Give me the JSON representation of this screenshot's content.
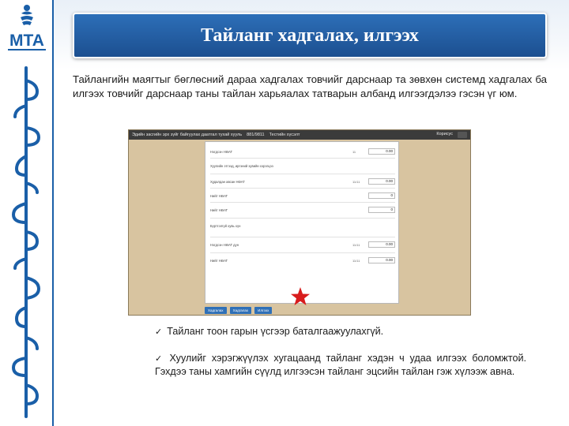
{
  "header": {
    "title": "Тайланг хадгалах, илгээх",
    "logo_text": "MTA"
  },
  "intro": "Тайлангийн маягтыг бөглөсний дараа хадгалах товчийг дарснаар та зөвхөн системд хадгалах ба илгээх товчийг дарснаар таны тайлан харьяалах татварын албанд илгээгдэлээ гэсэн үг юм.",
  "screenshot": {
    "title": "Эдийн засгийн эрх зүйг байгуулах даатгал тухай хууль",
    "code": "881/9811",
    "test": "Тестийн хүсэлт",
    "user": "Корисус",
    "rows": [
      {
        "label": "Нэгдсэн НӨАТ",
        "code": "11",
        "value": "0.00"
      },
      {
        "label": "Хуулийн этгээд, иргэний хувийн хэрэгцээ",
        "code": "",
        "value": ""
      },
      {
        "label": "Худалдан авсан НӨАТ",
        "code": "11/11",
        "value": "0.00"
      },
      {
        "label": "Нийт НӨАТ",
        "code": "",
        "value": "0"
      },
      {
        "label": "Нийт НӨАТ",
        "code": "",
        "value": "0"
      },
      {
        "label": "Бүртгэлгүй хувь хүн",
        "code": "",
        "value": ""
      },
      {
        "label": "Нэгдсэн НӨАТ дүн",
        "code": "11/11",
        "value": "0.00"
      },
      {
        "label": "Нийт НӨАТ",
        "code": "11/11",
        "value": "0.00"
      }
    ],
    "buttons": [
      "Хадгалах",
      "Хадгалах",
      "Илгээх"
    ]
  },
  "notes": [
    "Тайланг тоон гарын үсгээр баталгаажуулахгүй.",
    "Хуулийг хэрэгжүүлэх хугацаанд тайланг хэдэн ч удаа илгээх боломжтой. Гэхдээ таны хамгийн сүүлд илгээсэн тайланг эцсийн тайлан гэж хүлээж авна."
  ],
  "check_mark": "✓",
  "colors": {
    "brand": "#1c4f90",
    "accent": "#d81c1c"
  }
}
